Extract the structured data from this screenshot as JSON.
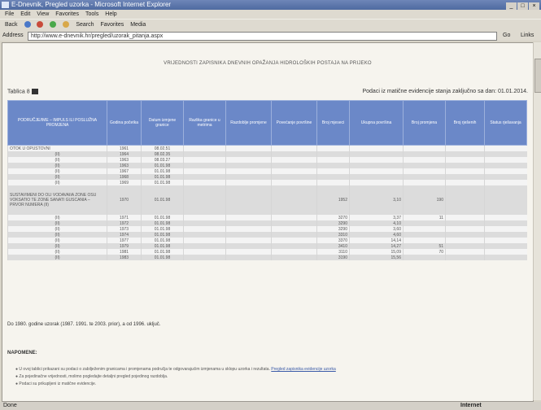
{
  "window": {
    "title": "E-Dnevnik, Pregled uzorka - Microsoft Internet Explorer"
  },
  "menu": [
    "File",
    "Edit",
    "View",
    "Favorites",
    "Tools",
    "Help"
  ],
  "toolbar": {
    "back": "Back",
    "search": "Search",
    "favorites": "Favorites",
    "media": "Media"
  },
  "address": {
    "label": "Address",
    "value": "http://www.e-dnevnik.hr/pregled/uzorak_pitanja.aspx",
    "go": "Go",
    "links": "Links"
  },
  "page": {
    "heading": "VRIJEDNOSTI ZAPISNIKA DNEVNIH OPAŽANJA HIDROLOŠKIH POSTAJA NA PRIJEKO",
    "table_label": "Tablica 8",
    "as_of": "Podaci iz matične evidencije stanja zaključno sa dan: 01.01.2014.",
    "columns": [
      "PODRUČJE/IME – IMPULS ILI POSLUŽNA PROMJENA",
      "Godina početka",
      "Datum izmjene granice",
      "Razlika granice u metrima",
      "Razdoblje promjene",
      "Povećanje površine",
      "Broj mjeseci",
      "Ukupna površina",
      "Broj promjena",
      "Broj rješenih",
      "Status rješavanja"
    ],
    "rows": [
      {
        "name": "OTOK U OPUSTOVNI",
        "year": "1961",
        "date": "08.02.51",
        "c3": "",
        "c4": "",
        "c5": "",
        "c6": "",
        "c7": "",
        "c8": "",
        "c9": "",
        "c10": ""
      },
      {
        "name": "(II)",
        "year": "1964",
        "date": "08.02.35",
        "c3": "",
        "c4": "",
        "c5": "",
        "c6": "",
        "c7": "",
        "c8": "",
        "c9": "",
        "c10": ""
      },
      {
        "name": "(II)",
        "year": "1963",
        "date": "08.03.27",
        "c3": "",
        "c4": "",
        "c5": "",
        "c6": "",
        "c7": "",
        "c8": "",
        "c9": "",
        "c10": ""
      },
      {
        "name": "(II)",
        "year": "1963",
        "date": "01.01.98",
        "c3": "",
        "c4": "",
        "c5": "",
        "c6": "",
        "c7": "",
        "c8": "",
        "c9": "",
        "c10": ""
      },
      {
        "name": "(II)",
        "year": "1967",
        "date": "01.01.98",
        "c3": "",
        "c4": "",
        "c5": "",
        "c6": "",
        "c7": "",
        "c8": "",
        "c9": "",
        "c10": ""
      },
      {
        "name": "(II)",
        "year": "1968",
        "date": "01.01.98",
        "c3": "",
        "c4": "",
        "c5": "",
        "c6": "",
        "c7": "",
        "c8": "",
        "c9": "",
        "c10": ""
      },
      {
        "name": "(II)",
        "year": "1969",
        "date": "01.01.98",
        "c3": "",
        "c4": "",
        "c5": "",
        "c6": "",
        "c7": "",
        "c8": "",
        "c9": "",
        "c10": ""
      },
      {
        "name": "SUSTAVIMENI DO OLI VODAVAIIA ZONE OSU VOKSATIO TE ZONE SANATI GUSCANIA – PRVOR NUMERA (II)",
        "year": "1970",
        "date": "01.01.98",
        "c3": "",
        "c4": "",
        "c5": "",
        "c6": "1952",
        "c7": "3,10",
        "c8": "190",
        "c9": "",
        "c10": "",
        "tall": true
      },
      {
        "name": "(II)",
        "year": "1971",
        "date": "01.01.98",
        "c3": "",
        "c4": "",
        "c5": "",
        "c6": "3270",
        "c7": "3,37",
        "c8": "11",
        "c9": "",
        "c10": ""
      },
      {
        "name": "(II)",
        "year": "1972",
        "date": "01.01.98",
        "c3": "",
        "c4": "",
        "c5": "",
        "c6": "3290",
        "c7": "4,10",
        "c8": "",
        "c9": "",
        "c10": ""
      },
      {
        "name": "(II)",
        "year": "1973",
        "date": "01.01.98",
        "c3": "",
        "c4": "",
        "c5": "",
        "c6": "3290",
        "c7": "3,60",
        "c8": "",
        "c9": "",
        "c10": ""
      },
      {
        "name": "(II)",
        "year": "1974",
        "date": "01.01.98",
        "c3": "",
        "c4": "",
        "c5": "",
        "c6": "3310",
        "c7": "4,60",
        "c8": "",
        "c9": "",
        "c10": ""
      },
      {
        "name": "(II)",
        "year": "1977",
        "date": "01.01.98",
        "c3": "",
        "c4": "",
        "c5": "",
        "c6": "3370",
        "c7": "14,14",
        "c8": "",
        "c9": "",
        "c10": ""
      },
      {
        "name": "(II)",
        "year": "1979",
        "date": "01.01.98",
        "c3": "",
        "c4": "",
        "c5": "",
        "c6": "3410",
        "c7": "14,27",
        "c8": "51",
        "c9": "",
        "c10": ""
      },
      {
        "name": "(II)",
        "year": "1981",
        "date": "01.01.98",
        "c3": "",
        "c4": "",
        "c5": "",
        "c6": "3110",
        "c7": "15,09",
        "c8": "70",
        "c9": "",
        "c10": ""
      },
      {
        "name": "(II)",
        "year": "1983",
        "date": "01.01.98",
        "c3": "",
        "c4": "",
        "c5": "",
        "c6": "3190",
        "c7": "15,56",
        "c8": "",
        "c9": "",
        "c10": ""
      }
    ],
    "footnote": "Do 1980. godine uzorak (1987. 1991. te 2003. prior), a od 1996. uključ.",
    "notes_title": "NAPOMENE:",
    "notes": [
      "U ovoj tablici prikazani su podaci o zabilježenim granicama i promjenama područja te odgovarajućim izmjenama u sklopu uzorka i rezultata.",
      "Za pojedinačne vrijednosti, molimo pogledajte detaljni pregled pojedinog razdoblja.",
      "Podaci su prikupljeni iz matične evidencije."
    ],
    "note_link": "Pregled zapisnika evidencije uzorka"
  },
  "status": {
    "left": "Done",
    "zone": "Internet"
  }
}
